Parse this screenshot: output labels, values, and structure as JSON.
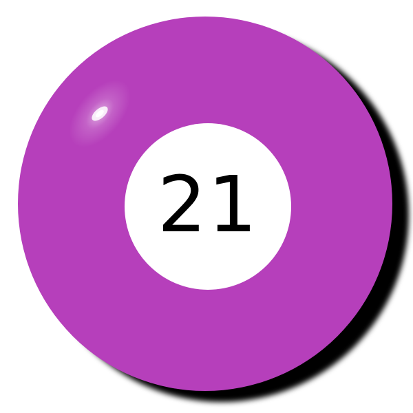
{
  "ball": {
    "number": "21",
    "color": "#b63fbb",
    "center_color": "#ffffff",
    "number_color": "#000000",
    "shadow_color": "#000000"
  }
}
